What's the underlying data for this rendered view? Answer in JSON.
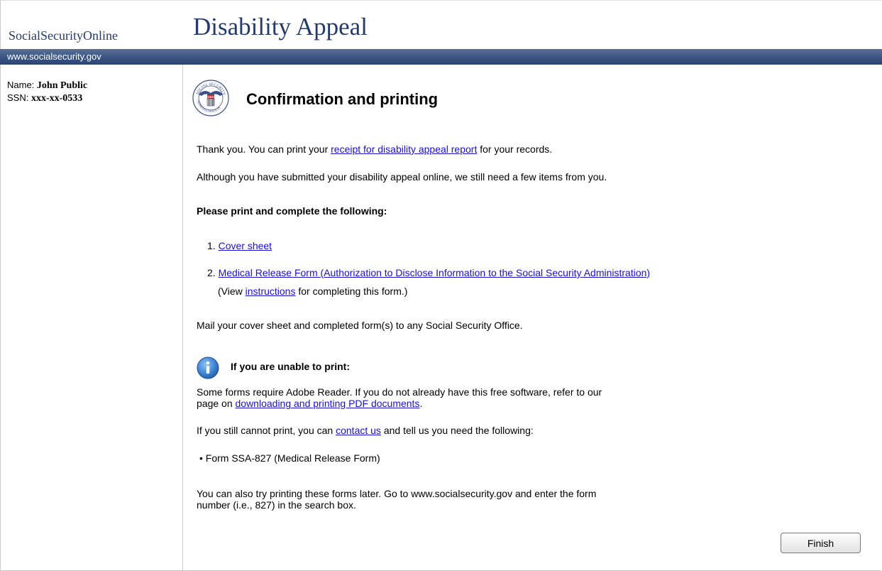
{
  "header": {
    "brand": "SocialSecurityOnline",
    "app_title": "Disability Appeal",
    "site_url": "www.socialsecurity.gov"
  },
  "user": {
    "name_label": "Name:",
    "name_value": "John Public",
    "ssn_label": "SSN:",
    "ssn_value": "xxx-xx-0533"
  },
  "main": {
    "seal_alt": "Social Security Administration seal",
    "seal_text_top": "SOCIAL SECURITY",
    "seal_text_bottom": "ADMINISTRATION",
    "seal_usa": "USA",
    "heading": "Confirmation and printing",
    "receipt": {
      "pre": "Thank you. You can print your ",
      "link": "receipt for disability appeal report",
      "post": " for your records."
    },
    "still_need": "Although you have submitted your disability appeal online, we still need a few items from you.",
    "print_heading": "Please print and complete the following:",
    "items": [
      {
        "num": "1. ",
        "link": "Cover sheet"
      },
      {
        "num": "2. ",
        "link": "Medical Release Form (Authorization to Disclose Information to the Social Security Administration)"
      }
    ],
    "instructions": {
      "pre": "(View ",
      "link": "instructions",
      "post": " for completing this form.)"
    },
    "mail_text": "Mail your cover sheet and completed form(s) to any Social Security Office.",
    "unable": {
      "title": "If you are unable to print:",
      "adobe_line1": "Some forms require Adobe Reader. If you do not already have this free software, refer to our",
      "adobe_line2_pre": "page on ",
      "adobe_link": "downloading and printing PDF documents",
      "adobe_line2_post": ".",
      "contact_pre": "If you still cannot print, you can ",
      "contact_link": "contact us",
      "contact_post": " and tell us you need the following:",
      "bullet": "• Form SSA-827 (Medical Release Form)",
      "later_line1": "You can also try printing these forms later. Go to www.socialsecurity.gov and enter the form",
      "later_line2": "number (i.e., 827) in the search box."
    },
    "finish_label": "Finish"
  },
  "colors": {
    "brand_text": "#233a6b",
    "bar": "#3a5482",
    "link": "#1a0fd4"
  }
}
